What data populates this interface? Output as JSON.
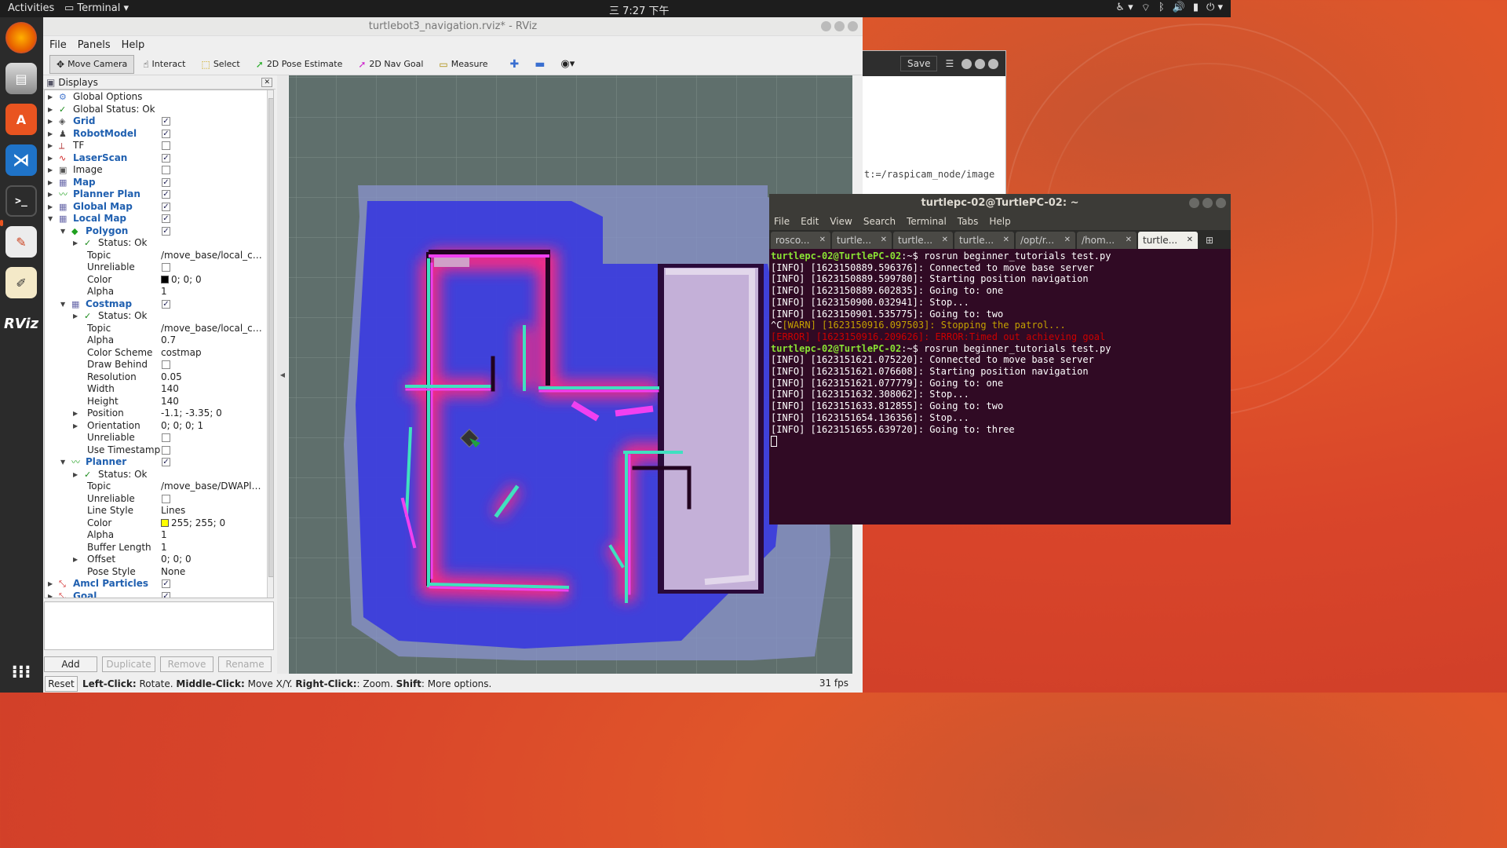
{
  "topbar": {
    "activities": "Activities",
    "app": "Terminal",
    "clock": "7:27 下午"
  },
  "dock": [
    "firefox-icon",
    "files-icon",
    "software-icon",
    "vscode-icon",
    "terminal-icon",
    "doc-viewer-icon",
    "text-editor-icon",
    "rviz-icon"
  ],
  "bgwin": {
    "save": "Save",
    "text": "t:=/raspicam_node/image"
  },
  "rviz": {
    "title": "turtlebot3_navigation.rviz* - RViz",
    "menu": {
      "file": "File",
      "panels": "Panels",
      "help": "Help"
    },
    "toolbar": {
      "move_camera": "Move Camera",
      "interact": "Interact",
      "select": "Select",
      "pose_estimate": "2D Pose Estimate",
      "nav_goal": "2D Nav Goal",
      "measure": "Measure"
    },
    "panel_title": "Displays",
    "tree": [
      {
        "l": "Global Options",
        "lvl": 0,
        "arrow": "▶",
        "icon": "⚙",
        "icolor": "#4a7bd0",
        "blue": false,
        "chk": null,
        "val": ""
      },
      {
        "l": "Global Status: Ok",
        "lvl": 0,
        "arrow": "▶",
        "icon": "✓",
        "icolor": "#1a8a1a",
        "blue": false,
        "chk": null,
        "val": ""
      },
      {
        "l": "Grid",
        "lvl": 0,
        "arrow": "▶",
        "icon": "◈",
        "icolor": "#555",
        "blue": true,
        "chk": true,
        "val": ""
      },
      {
        "l": "RobotModel",
        "lvl": 0,
        "arrow": "▶",
        "icon": "♟",
        "icolor": "#444",
        "blue": true,
        "chk": true,
        "val": ""
      },
      {
        "l": "TF",
        "lvl": 0,
        "arrow": "▶",
        "icon": "⟂",
        "icolor": "#b03030",
        "blue": false,
        "chk": false,
        "val": ""
      },
      {
        "l": "LaserScan",
        "lvl": 0,
        "arrow": "▶",
        "icon": "∿",
        "icolor": "#d02020",
        "blue": true,
        "chk": true,
        "val": ""
      },
      {
        "l": "Image",
        "lvl": 0,
        "arrow": "▶",
        "icon": "▣",
        "icolor": "#555",
        "blue": false,
        "chk": false,
        "val": ""
      },
      {
        "l": "Map",
        "lvl": 0,
        "arrow": "▶",
        "icon": "▦",
        "icolor": "#6a6aaa",
        "blue": true,
        "chk": true,
        "val": ""
      },
      {
        "l": "Planner Plan",
        "lvl": 0,
        "arrow": "▶",
        "icon": "〰",
        "icolor": "#20a020",
        "blue": true,
        "chk": true,
        "val": ""
      },
      {
        "l": "Global Map",
        "lvl": 0,
        "arrow": "▶",
        "icon": "▦",
        "icolor": "#6a6aaa",
        "blue": true,
        "chk": true,
        "val": ""
      },
      {
        "l": "Local Map",
        "lvl": 0,
        "arrow": "▼",
        "icon": "▦",
        "icolor": "#6a6aaa",
        "blue": true,
        "chk": true,
        "val": ""
      },
      {
        "l": "Polygon",
        "lvl": 1,
        "arrow": "▼",
        "icon": "◆",
        "icolor": "#20a020",
        "blue": true,
        "chk": true,
        "val": ""
      },
      {
        "l": "Status: Ok",
        "lvl": 2,
        "arrow": "▶",
        "icon": "✓",
        "icolor": "#1a8a1a",
        "blue": false,
        "chk": null,
        "val": ""
      },
      {
        "l": "Topic",
        "lvl": 2,
        "arrow": "",
        "icon": "",
        "icolor": "",
        "blue": false,
        "chk": null,
        "val": "/move_base/local_co..."
      },
      {
        "l": "Unreliable",
        "lvl": 2,
        "arrow": "",
        "icon": "",
        "icolor": "",
        "blue": false,
        "chk": false,
        "val": ""
      },
      {
        "l": "Color",
        "lvl": 2,
        "arrow": "",
        "icon": "",
        "icolor": "",
        "blue": false,
        "chk": null,
        "val": "0; 0; 0",
        "swatch": "#000000"
      },
      {
        "l": "Alpha",
        "lvl": 2,
        "arrow": "",
        "icon": "",
        "icolor": "",
        "blue": false,
        "chk": null,
        "val": "1"
      },
      {
        "l": "Costmap",
        "lvl": 1,
        "arrow": "▼",
        "icon": "▦",
        "icolor": "#6a6aaa",
        "blue": true,
        "chk": true,
        "val": ""
      },
      {
        "l": "Status: Ok",
        "lvl": 2,
        "arrow": "▶",
        "icon": "✓",
        "icolor": "#1a8a1a",
        "blue": false,
        "chk": null,
        "val": ""
      },
      {
        "l": "Topic",
        "lvl": 2,
        "arrow": "",
        "icon": "",
        "icolor": "",
        "blue": false,
        "chk": null,
        "val": "/move_base/local_co..."
      },
      {
        "l": "Alpha",
        "lvl": 2,
        "arrow": "",
        "icon": "",
        "icolor": "",
        "blue": false,
        "chk": null,
        "val": "0.7"
      },
      {
        "l": "Color Scheme",
        "lvl": 2,
        "arrow": "",
        "icon": "",
        "icolor": "",
        "blue": false,
        "chk": null,
        "val": "costmap"
      },
      {
        "l": "Draw Behind",
        "lvl": 2,
        "arrow": "",
        "icon": "",
        "icolor": "",
        "blue": false,
        "chk": false,
        "val": ""
      },
      {
        "l": "Resolution",
        "lvl": 2,
        "arrow": "",
        "icon": "",
        "icolor": "",
        "blue": false,
        "chk": null,
        "val": "0.05"
      },
      {
        "l": "Width",
        "lvl": 2,
        "arrow": "",
        "icon": "",
        "icolor": "",
        "blue": false,
        "chk": null,
        "val": "140"
      },
      {
        "l": "Height",
        "lvl": 2,
        "arrow": "",
        "icon": "",
        "icolor": "",
        "blue": false,
        "chk": null,
        "val": "140"
      },
      {
        "l": "Position",
        "lvl": 2,
        "arrow": "▶",
        "icon": "",
        "icolor": "",
        "blue": false,
        "chk": null,
        "val": "-1.1; -3.35; 0"
      },
      {
        "l": "Orientation",
        "lvl": 2,
        "arrow": "▶",
        "icon": "",
        "icolor": "",
        "blue": false,
        "chk": null,
        "val": "0; 0; 0; 1"
      },
      {
        "l": "Unreliable",
        "lvl": 2,
        "arrow": "",
        "icon": "",
        "icolor": "",
        "blue": false,
        "chk": false,
        "val": ""
      },
      {
        "l": "Use Timestamp",
        "lvl": 2,
        "arrow": "",
        "icon": "",
        "icolor": "",
        "blue": false,
        "chk": false,
        "val": ""
      },
      {
        "l": "Planner",
        "lvl": 1,
        "arrow": "▼",
        "icon": "〰",
        "icolor": "#20a020",
        "blue": true,
        "chk": true,
        "val": ""
      },
      {
        "l": "Status: Ok",
        "lvl": 2,
        "arrow": "▶",
        "icon": "✓",
        "icolor": "#1a8a1a",
        "blue": false,
        "chk": null,
        "val": ""
      },
      {
        "l": "Topic",
        "lvl": 2,
        "arrow": "",
        "icon": "",
        "icolor": "",
        "blue": false,
        "chk": null,
        "val": "/move_base/DWAPla..."
      },
      {
        "l": "Unreliable",
        "lvl": 2,
        "arrow": "",
        "icon": "",
        "icolor": "",
        "blue": false,
        "chk": false,
        "val": ""
      },
      {
        "l": "Line Style",
        "lvl": 2,
        "arrow": "",
        "icon": "",
        "icolor": "",
        "blue": false,
        "chk": null,
        "val": "Lines"
      },
      {
        "l": "Color",
        "lvl": 2,
        "arrow": "",
        "icon": "",
        "icolor": "",
        "blue": false,
        "chk": null,
        "val": "255; 255; 0",
        "swatch": "#ffff00"
      },
      {
        "l": "Alpha",
        "lvl": 2,
        "arrow": "",
        "icon": "",
        "icolor": "",
        "blue": false,
        "chk": null,
        "val": "1"
      },
      {
        "l": "Buffer Length",
        "lvl": 2,
        "arrow": "",
        "icon": "",
        "icolor": "",
        "blue": false,
        "chk": null,
        "val": "1"
      },
      {
        "l": "Offset",
        "lvl": 2,
        "arrow": "▶",
        "icon": "",
        "icolor": "",
        "blue": false,
        "chk": null,
        "val": "0; 0; 0"
      },
      {
        "l": "Pose Style",
        "lvl": 2,
        "arrow": "",
        "icon": "",
        "icolor": "",
        "blue": false,
        "chk": null,
        "val": "None"
      },
      {
        "l": "Amcl Particles",
        "lvl": 0,
        "arrow": "▶",
        "icon": "⤡",
        "icolor": "#d02020",
        "blue": true,
        "chk": true,
        "val": ""
      },
      {
        "l": "Goal",
        "lvl": 0,
        "arrow": "▶",
        "icon": "⤡",
        "icolor": "#d02020",
        "blue": true,
        "chk": true,
        "val": ""
      }
    ],
    "buttons": {
      "add": "Add",
      "duplicate": "Duplicate",
      "remove": "Remove",
      "rename": "Rename"
    },
    "status": {
      "reset": "Reset",
      "hint_html": [
        [
          "b",
          "Left-Click:"
        ],
        [
          "t",
          " Rotate. "
        ],
        [
          "b",
          "Middle-Click:"
        ],
        [
          "t",
          " Move X/Y. "
        ],
        [
          "b",
          "Right-Click:"
        ],
        [
          "t",
          ": Zoom. "
        ],
        [
          "b",
          "Shift"
        ],
        [
          "t",
          ": More options."
        ]
      ],
      "fps": "31 fps"
    }
  },
  "terminal": {
    "title": "turtlepc-02@TurtlePC-02: ~",
    "menu": [
      "File",
      "Edit",
      "View",
      "Search",
      "Terminal",
      "Tabs",
      "Help"
    ],
    "tabs": [
      "rosco...",
      "turtle...",
      "turtle...",
      "turtle...",
      "/opt/r...",
      "/hom...",
      "turtle..."
    ],
    "lines": [
      {
        "type": "prompt",
        "p": "turtlepc-02@TurtlePC-02",
        "rest": ":~$ rosrun beginner_tutorials test.py"
      },
      {
        "type": "info",
        "text": "[INFO] [1623150889.596376]: Connected to move base server"
      },
      {
        "type": "info",
        "text": "[INFO] [1623150889.599780]: Starting position navigation"
      },
      {
        "type": "info",
        "text": "[INFO] [1623150889.602835]: Going to: one"
      },
      {
        "type": "info",
        "text": "[INFO] [1623150900.032941]: Stop..."
      },
      {
        "type": "info",
        "text": "[INFO] [1623150901.535775]: Going to: two"
      },
      {
        "type": "warn",
        "pre": "^C",
        "text": "[WARN] [1623150916.097503]: Stopping the patrol..."
      },
      {
        "type": "err",
        "text": "[ERROR] [1623150916.209626]: ERROR:Timed out achieving goal"
      },
      {
        "type": "prompt",
        "p": "turtlepc-02@TurtlePC-02",
        "rest": ":~$ rosrun beginner_tutorials test.py"
      },
      {
        "type": "info",
        "text": "[INFO] [1623151621.075220]: Connected to move base server"
      },
      {
        "type": "info",
        "text": "[INFO] [1623151621.076608]: Starting position navigation"
      },
      {
        "type": "info",
        "text": "[INFO] [1623151621.077779]: Going to: one"
      },
      {
        "type": "info",
        "text": "[INFO] [1623151632.308062]: Stop..."
      },
      {
        "type": "info",
        "text": "[INFO] [1623151633.812855]: Going to: two"
      },
      {
        "type": "info",
        "text": "[INFO] [1623151654.136356]: Stop..."
      },
      {
        "type": "info",
        "text": "[INFO] [1623151655.639720]: Going to: three"
      }
    ]
  }
}
